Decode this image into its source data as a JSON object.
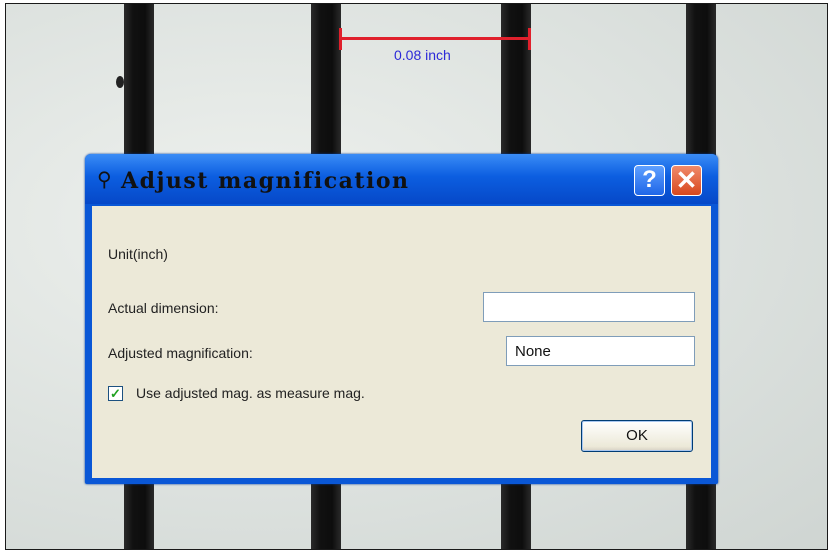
{
  "measurement": {
    "label": "0.08 inch",
    "color": "#e0202c",
    "label_color": "#2c2ad8"
  },
  "dialog": {
    "title": "Adjust magnification",
    "icon": "microscope-icon",
    "help_glyph": "?",
    "close_glyph": "✕",
    "unit_label": "Unit(inch)",
    "actual_dimension_label": "Actual dimension:",
    "actual_dimension_value": "",
    "adjusted_magnification_label": "Adjusted magnification:",
    "adjusted_magnification_value": "None",
    "checkbox_label": "Use adjusted mag. as measure mag.",
    "checkbox_checked": true,
    "ok_label": "OK"
  }
}
